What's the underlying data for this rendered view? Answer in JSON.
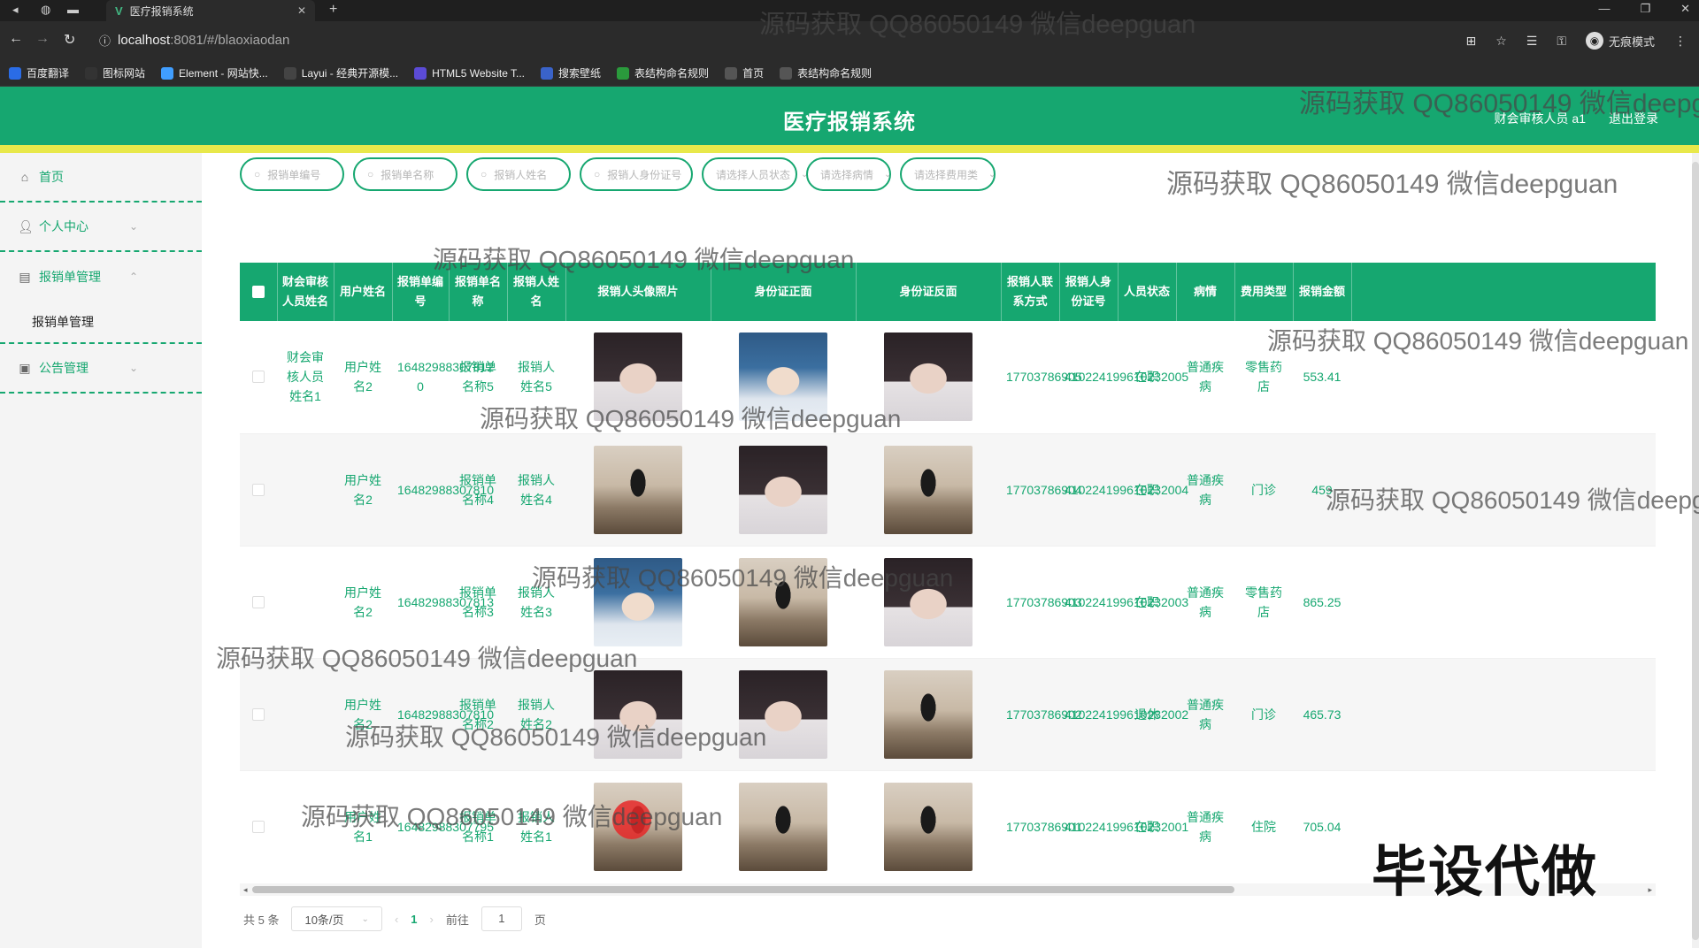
{
  "browser": {
    "tab_title": "医疗报销系统",
    "url_host": "localhost",
    "url_path": ":8081/#/blaoxiaodan",
    "incognito_label": "无痕模式",
    "bookmarks": [
      {
        "label": "百度翻译",
        "color": "#2a6ce6"
      },
      {
        "label": "图标网站",
        "color": "#333333"
      },
      {
        "label": "Element - 网站快...",
        "color": "#409eff"
      },
      {
        "label": "Layui - 经典开源模...",
        "color": "#444444"
      },
      {
        "label": "HTML5 Website T...",
        "color": "#5b4bd6"
      },
      {
        "label": "搜索壁纸",
        "color": "#3a63c9"
      },
      {
        "label": "表结构命名规则",
        "color": "#2a9a3c"
      },
      {
        "label": "首页",
        "color": "#555555"
      },
      {
        "label": "表结构命名规则",
        "color": "#555555"
      }
    ]
  },
  "header": {
    "title": "医疗报销系统",
    "user": "财会审核人员 a1",
    "logout": "退出登录",
    "accent": "#16a770",
    "bar_color": "#e8e84a"
  },
  "sidebar": {
    "home": "首页",
    "personal": "个人中心",
    "reimburse": "报销单管理",
    "reimburse_sub": "报销单管理",
    "notice": "公告管理"
  },
  "filters": [
    {
      "placeholder": "报销单编号",
      "icon": "search-icon"
    },
    {
      "placeholder": "报销单名称",
      "icon": "search-icon"
    },
    {
      "placeholder": "报销人姓名",
      "icon": "search-icon"
    },
    {
      "placeholder": "报销人身份证号",
      "icon": "search-icon"
    },
    {
      "placeholder": "请选择人员状态",
      "icon": "chevron-down-icon"
    },
    {
      "placeholder": "请选择病情",
      "icon": "chevron-down-icon"
    },
    {
      "placeholder": "请选择费用类",
      "icon": "chevron-down-icon"
    }
  ],
  "table": {
    "headers": [
      "财会审核人员姓名",
      "用户姓名",
      "报销单编号",
      "报销单名称",
      "报销人姓名",
      "报销人头像照片",
      "身份证正面",
      "身份证反面",
      "报销人联系方式",
      "报销人身份证号",
      "人员状态",
      "病情",
      "费用类型",
      "报销金额"
    ],
    "rows": [
      {
        "auditor": "财会审核人员姓名1",
        "user": "用户姓名2",
        "code": "16482988307812 0",
        "name": "报销单名称5",
        "person": "报销人姓名5",
        "photo": "girl",
        "idf": "boy",
        "idb": "girl",
        "phone": "17703786905",
        "idno": "410224199610232005",
        "status": "在职",
        "illness": "普通疾病",
        "ftype": "零售药店",
        "amount": "553.41"
      },
      {
        "auditor": "",
        "user": "用户姓名2",
        "code": "16482988307810",
        "name": "报销单名称4",
        "person": "报销人姓名4",
        "photo": "man",
        "idf": "girl",
        "idb": "man",
        "phone": "17703786904",
        "idno": "410224199610232004",
        "status": "在职",
        "illness": "普通疾病",
        "ftype": "门诊",
        "amount": "459"
      },
      {
        "auditor": "",
        "user": "用户姓名2",
        "code": "16482988307813",
        "name": "报销单名称3",
        "person": "报销人姓名3",
        "photo": "boy",
        "idf": "man",
        "idb": "girl",
        "phone": "17703786903",
        "idno": "410224199610232003",
        "status": "在职",
        "illness": "普通疾病",
        "ftype": "零售药店",
        "amount": "865.25"
      },
      {
        "auditor": "",
        "user": "用户姓名2",
        "code": "16482988307810",
        "name": "报销单名称2",
        "person": "报销人姓名2",
        "photo": "girl",
        "idf": "girl",
        "idb": "man",
        "phone": "17703786902",
        "idno": "410224199610232002",
        "status": "退休",
        "illness": "普通疾病",
        "ftype": "门诊",
        "amount": "465.73"
      },
      {
        "auditor": "",
        "user": "用户姓名1",
        "code": "16482988307795",
        "name": "报销单名称1",
        "person": "报销人姓名1",
        "photo": "man",
        "idf": "man",
        "idb": "man",
        "phone": "17703786901",
        "idno": "410224199610232001",
        "status": "在职",
        "illness": "普通疾病",
        "ftype": "住院",
        "amount": "705.04"
      }
    ]
  },
  "pagination": {
    "total": "共 5 条",
    "page_size": "10条/页",
    "current": "1",
    "goto_prefix": "前往",
    "goto_value": "1",
    "goto_suffix": "页"
  },
  "watermarks": {
    "text": "源码获取 QQ86050149 微信deepguan",
    "stamp": "毕设代做"
  }
}
